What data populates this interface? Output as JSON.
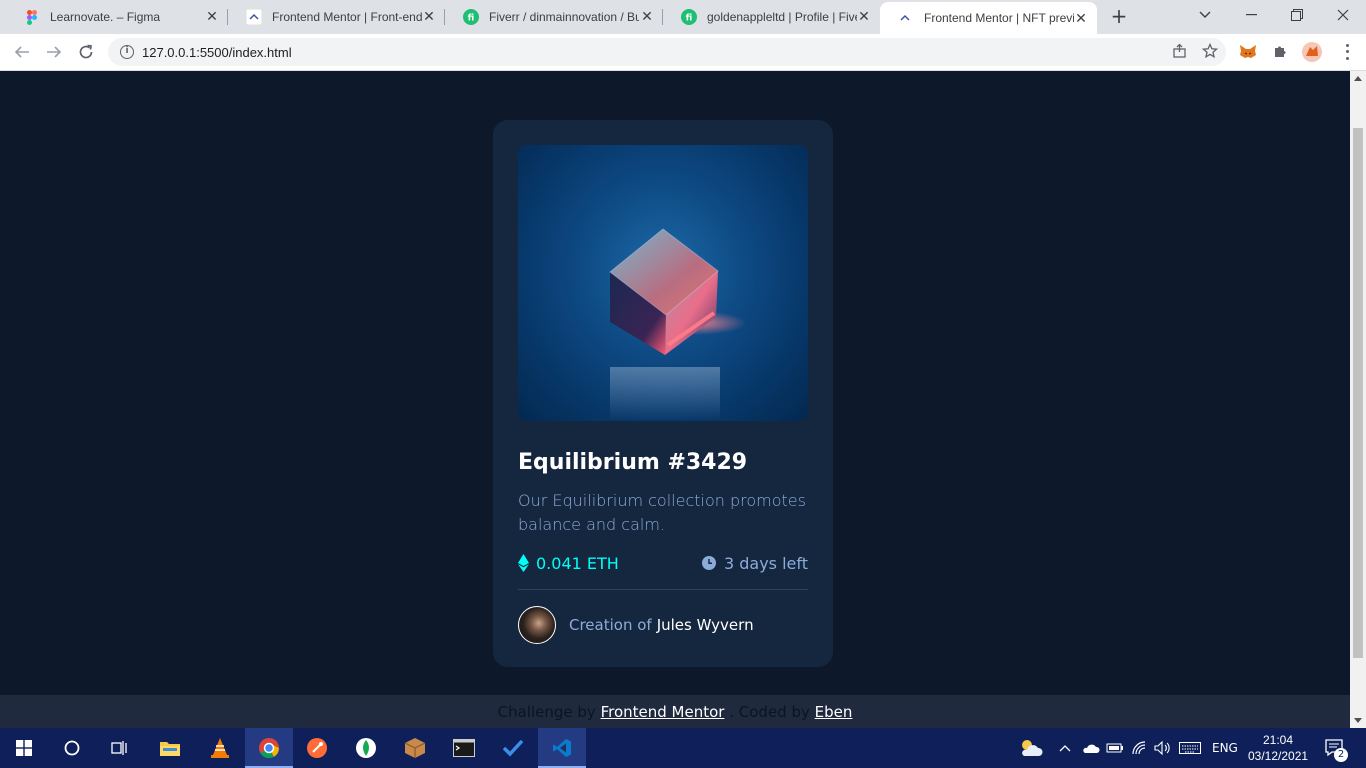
{
  "browser": {
    "tabs": [
      {
        "title": "Learnovate. – Figma",
        "icon": "figma-icon"
      },
      {
        "title": "Frontend Mentor | Front-end",
        "icon": "frontend-mentor-icon"
      },
      {
        "title": "Fiverr / dinmainnovation / Bu",
        "icon": "fiverr-icon"
      },
      {
        "title": "goldenappleltd | Profile | Five",
        "icon": "fiverr-icon"
      },
      {
        "title": "Frontend Mentor | NFT previ",
        "icon": "frontend-mentor-icon",
        "active": true
      }
    ],
    "url": "127.0.0.1:5500/index.html"
  },
  "card": {
    "title": "Equilibrium #3429",
    "description": "Our Equilibrium collection promotes balance and calm.",
    "price": "0.041 ETH",
    "time_left": "3 days left",
    "creator_prefix": "Creation of",
    "creator_name": "Jules Wyvern"
  },
  "attribution": {
    "prefix": "Challenge by",
    "link1": "Frontend Mentor",
    "middle": ". Coded by",
    "link2": "Eben"
  },
  "taskbar": {
    "language": "ENG",
    "time": "21:04",
    "date": "03/12/2021",
    "notification_count": "2"
  },
  "colors": {
    "page_bg": "#0d192b",
    "card_bg": "#15263f",
    "cyan": "#00fff8",
    "soft_blue": "#8bacd9",
    "white": "#ffffff"
  }
}
